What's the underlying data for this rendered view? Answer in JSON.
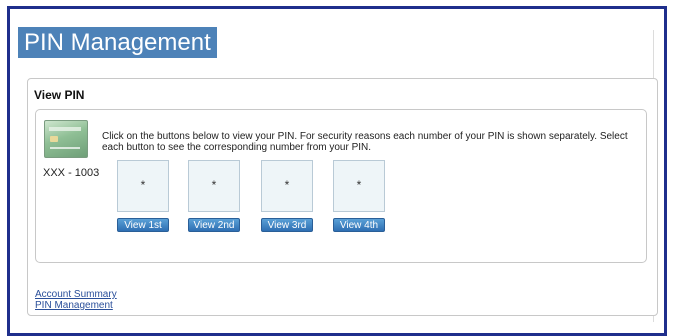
{
  "page": {
    "title": "PIN Management"
  },
  "panel": {
    "title": "View PIN",
    "card_number": "XXX - 1003",
    "instructions": "Click on the buttons below to view your PIN. For security reasons each number of your PIN is shown separately. Select each button to see the corresponding number from your PIN.",
    "pin_slots": [
      {
        "value": "*",
        "button_label": "View 1st"
      },
      {
        "value": "*",
        "button_label": "View 2nd"
      },
      {
        "value": "*",
        "button_label": "View 3rd"
      },
      {
        "value": "*",
        "button_label": "View 4th"
      }
    ]
  },
  "footer_links": {
    "account_summary": "Account Summary",
    "pin_management": "PIN Management"
  },
  "colors": {
    "frame_border": "#1f2f8c",
    "title_background": "#4d82b8",
    "button": "#3a7fc2",
    "link": "#2a4f9a"
  }
}
